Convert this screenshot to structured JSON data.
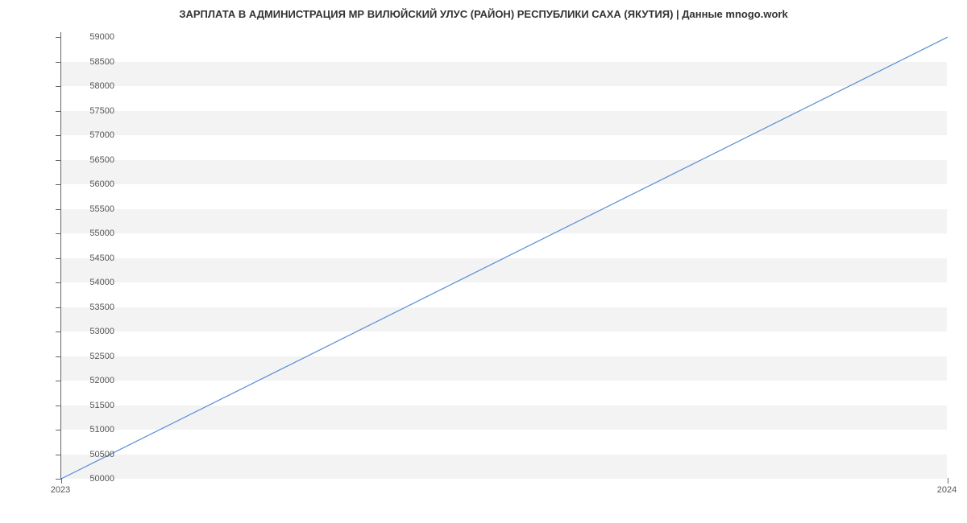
{
  "chart_data": {
    "type": "line",
    "title": "ЗАРПЛАТА В АДМИНИСТРАЦИЯ МР ВИЛЮЙСКИЙ УЛУС (РАЙОН) РЕСПУБЛИКИ САХА (ЯКУТИЯ) | Данные mnogo.work",
    "x": [
      2023,
      2024
    ],
    "values": [
      50000,
      59000
    ],
    "xlabel": "",
    "ylabel": "",
    "x_ticks": [
      2023,
      2024
    ],
    "y_ticks": [
      50000,
      50500,
      51000,
      51500,
      52000,
      52500,
      53000,
      53500,
      54000,
      54500,
      55000,
      55500,
      56000,
      56500,
      57000,
      57500,
      58000,
      58500,
      59000
    ],
    "ylim": [
      50000,
      59100
    ],
    "xlim": [
      2023,
      2024
    ],
    "line_color": "#5a8fd6"
  }
}
